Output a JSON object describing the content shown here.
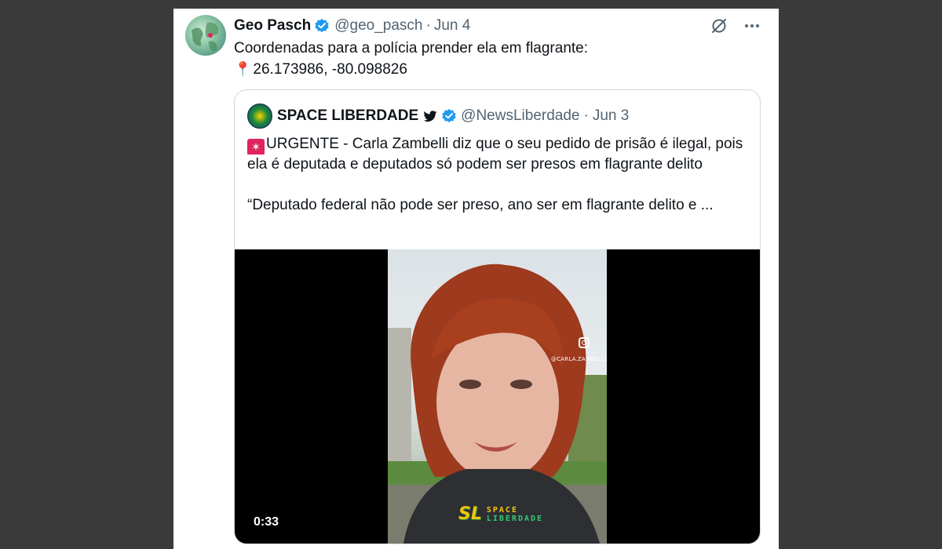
{
  "tweet": {
    "display_name": "Geo Pasch",
    "handle": "@geo_pasch",
    "separator": "·",
    "date": "Jun 4",
    "text_line1": "Coordenadas para a polícia prender ela em flagrante:",
    "pin_icon": "📍",
    "text_line2": "26.173986, -80.098826",
    "icons": [
      "grok-icon",
      "more-icon"
    ]
  },
  "quote": {
    "display_name": "SPACE LIBERDADE",
    "handle": "@NewsLiberdade",
    "separator": "·",
    "date": "Jun 3",
    "siren_icon": "🚨",
    "text_para1": "URGENTE - Carla Zambelli diz que o seu pedido de prisão é ilegal, pois ela é deputada e deputados só podem ser presos em flagrante delito",
    "text_para2": "“Deputado federal não pode ser preso,  ano ser em flagrante delito e ...",
    "video": {
      "duration": "0:33",
      "ig_tag": "@CARLA.ZAMBELLI",
      "watermark_logo": "SL",
      "watermark_line1": "SPACE",
      "watermark_line2": "LIBERDADE"
    }
  },
  "colors": {
    "verified_blue": "#1d9bf0",
    "text_primary": "#0f1419",
    "text_secondary": "#536471",
    "border": "#cfd9de"
  }
}
